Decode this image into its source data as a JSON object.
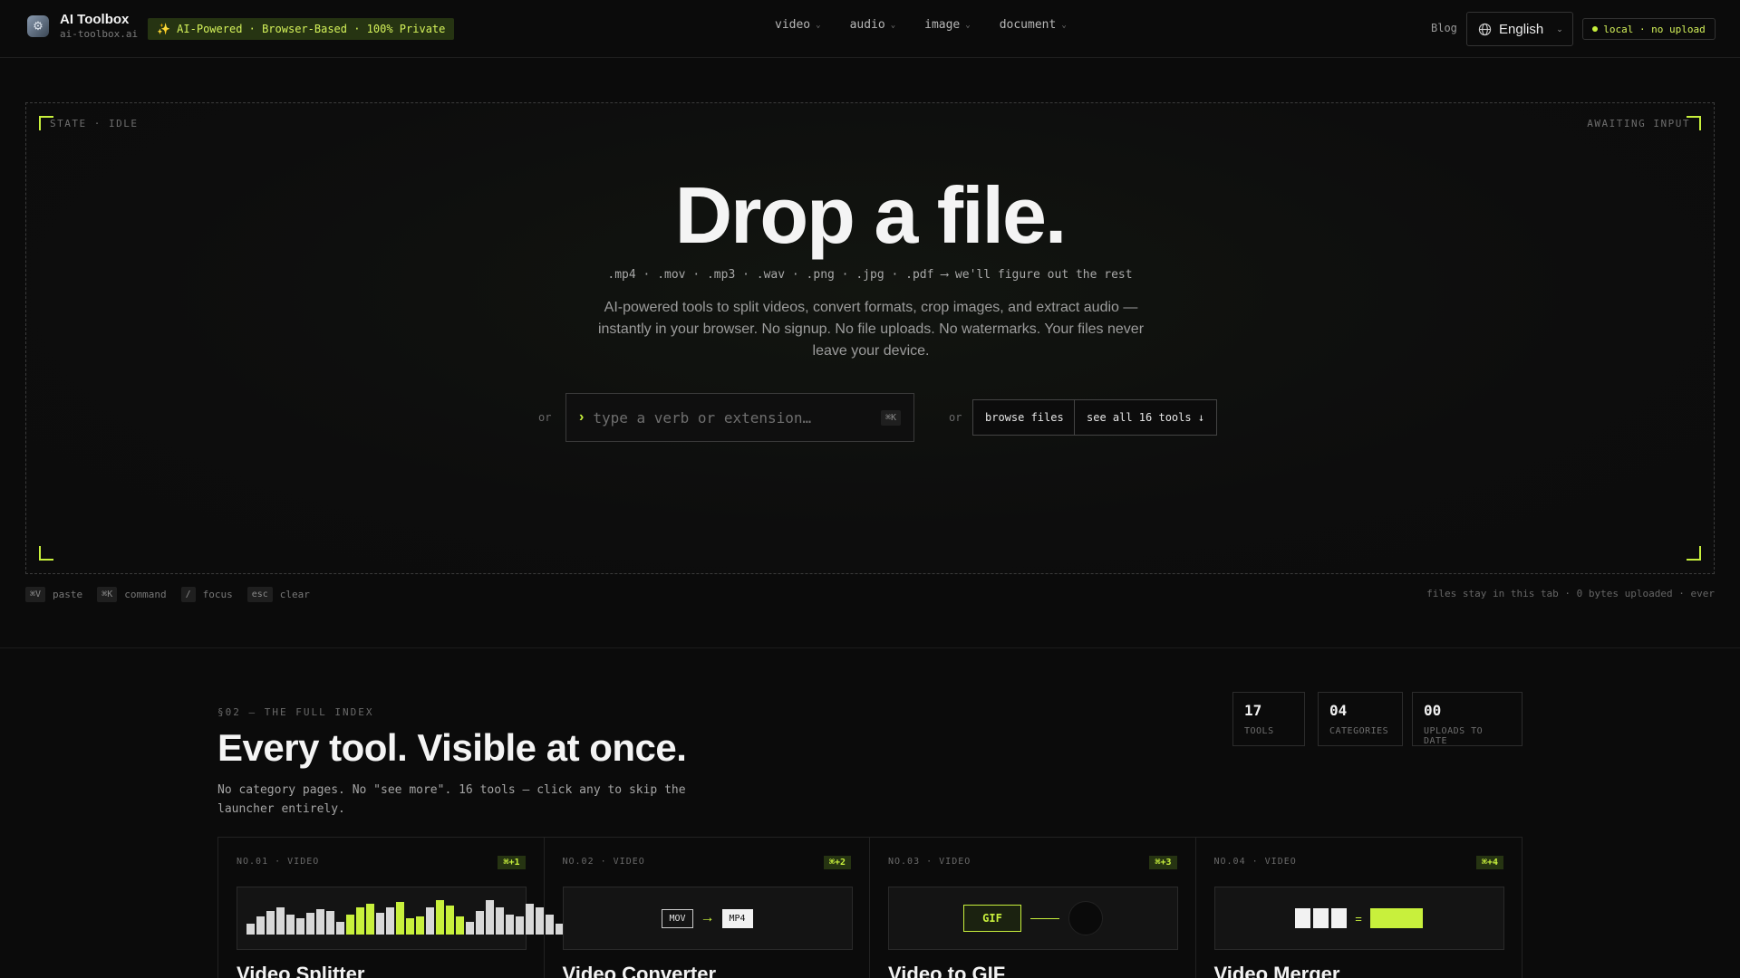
{
  "brand": {
    "name": "AI Toolbox",
    "domain": "ai-toolbox.ai",
    "badge": "✨ AI-Powered · Browser-Based · 100% Private"
  },
  "nav": {
    "items": [
      {
        "label": "video"
      },
      {
        "label": "audio"
      },
      {
        "label": "image"
      },
      {
        "label": "document"
      }
    ]
  },
  "header": {
    "blog": "Blog",
    "language": "English",
    "local_status": "local · no upload"
  },
  "drop": {
    "state": "STATE · IDLE",
    "awaiting": "AWAITING INPUT",
    "title": "Drop a file.",
    "extensions": ".mp4 · .mov · .mp3 · .wav · .png · .jpg · .pdf ⟶ we'll figure out the rest",
    "description": "AI-powered tools to split videos, convert formats, crop images, and extract audio — instantly in your browser. No signup. No file uploads. No watermarks. Your files never leave your device.",
    "or": "or",
    "search_placeholder": "type a verb or extension…",
    "search_kbd": "⌘K",
    "browse_label": "browse files",
    "see_all_label": "see all 16 tools ↓"
  },
  "shortcuts": [
    {
      "key": "⌘V",
      "label": "paste"
    },
    {
      "key": "⌘K",
      "label": "command"
    },
    {
      "key": "/",
      "label": "focus"
    },
    {
      "key": "esc",
      "label": "clear"
    }
  ],
  "privacy_note": "files stay in this tab · 0 bytes uploaded · ever",
  "index": {
    "label": "§02 — THE FULL INDEX",
    "title": "Every tool. Visible at once.",
    "description": "No category pages. No \"see more\". 16 tools — click any to skip the launcher entirely."
  },
  "stats": [
    {
      "value": "17",
      "label": "TOOLS"
    },
    {
      "value": "04",
      "label": "CATEGORIES"
    },
    {
      "value": "00",
      "label": "UPLOADS TO DATE"
    }
  ],
  "cards": [
    {
      "meta": "NO.01 · VIDEO",
      "key": "⌘+1",
      "title": "Video Splitter"
    },
    {
      "meta": "NO.02 · VIDEO",
      "key": "⌘+2",
      "title": "Video Converter",
      "from": "MOV",
      "to": "MP4"
    },
    {
      "meta": "NO.03 · VIDEO",
      "key": "⌘+3",
      "title": "Video to GIF",
      "badge": "GIF"
    },
    {
      "meta": "NO.04 · VIDEO",
      "key": "⌘+4",
      "title": "Video Merger",
      "eq": "="
    }
  ],
  "colors": {
    "accent": "#c8f03c",
    "background": "#0b0b0b",
    "badge_bg": "#263412"
  }
}
